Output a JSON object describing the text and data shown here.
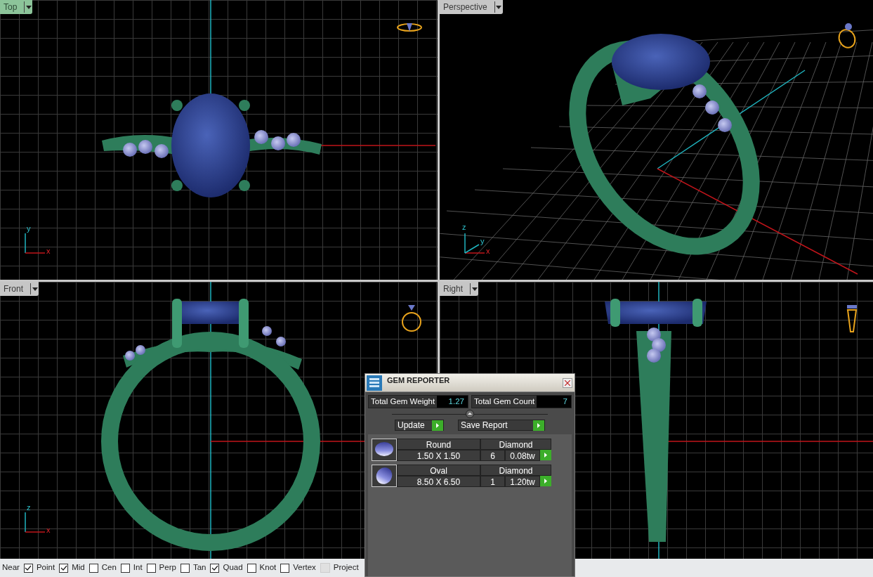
{
  "viewports": [
    {
      "title": "Top",
      "selected": true,
      "kind": "top",
      "axes": [
        "y",
        "x"
      ]
    },
    {
      "title": "Perspective",
      "selected": false,
      "kind": "perspective",
      "axes": [
        "z",
        "y",
        "x"
      ]
    },
    {
      "title": "Front",
      "selected": false,
      "kind": "front",
      "axes": [
        "z",
        "x"
      ]
    },
    {
      "title": "Right",
      "selected": false,
      "kind": "right"
    }
  ],
  "gem_reporter": {
    "title": "GEM REPORTER",
    "total_weight_label": "Total Gem Weight",
    "total_weight": "1.27",
    "total_count_label": "Total Gem Count",
    "total_count": "7",
    "buttons": [
      "Update",
      "Save Report"
    ],
    "gems": [
      {
        "kind": "round",
        "shape": "Round",
        "material": "Diamond",
        "size": "1.50 X 1.50",
        "count": "6",
        "weight": "0.08tw"
      },
      {
        "kind": "oval",
        "shape": "Oval",
        "material": "Diamond",
        "size": "8.50 X 6.50",
        "count": "1",
        "weight": "1.20tw"
      }
    ]
  },
  "osnap_bar": [
    {
      "kind": "label",
      "label": "Near"
    },
    {
      "kind": "checkbox",
      "label": "Point",
      "checked": true
    },
    {
      "kind": "checkbox",
      "label": "Mid",
      "checked": true
    },
    {
      "kind": "checkbox",
      "label": "Cen",
      "checked": false
    },
    {
      "kind": "checkbox",
      "label": "Int",
      "checked": false
    },
    {
      "kind": "checkbox",
      "label": "Perp",
      "checked": false
    },
    {
      "kind": "checkbox",
      "label": "Tan",
      "checked": false
    },
    {
      "kind": "checkbox",
      "label": "Quad",
      "checked": true
    },
    {
      "kind": "checkbox",
      "label": "Knot",
      "checked": false
    },
    {
      "kind": "checkbox",
      "label": "Vertex",
      "checked": false
    },
    {
      "kind": "disabled",
      "label": "Project",
      "checked": false
    }
  ]
}
